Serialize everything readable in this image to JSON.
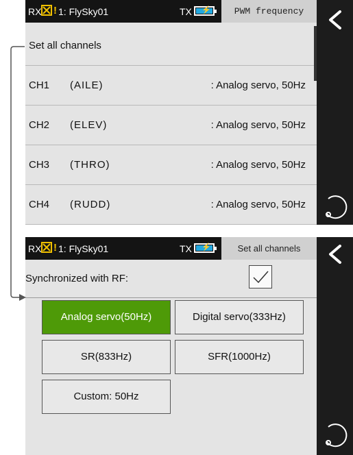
{
  "screen_top": {
    "status": {
      "rx": "RX",
      "warning": "!",
      "model": "1: FlySky01",
      "tx": "TX",
      "battery_bolt": "⚡"
    },
    "title": "PWM frequency",
    "set_all": "Set all channels",
    "channels": [
      {
        "ch": "CH1",
        "fn": "(AILE)",
        "value": ": Analog servo, 50Hz"
      },
      {
        "ch": "CH2",
        "fn": "(ELEV)",
        "value": ": Analog servo, 50Hz"
      },
      {
        "ch": "CH3",
        "fn": "(THRO)",
        "value": ": Analog servo, 50Hz"
      },
      {
        "ch": "CH4",
        "fn": "(RUDD)",
        "value": ": Analog servo, 50Hz"
      }
    ]
  },
  "screen_bottom": {
    "status": {
      "rx": "RX",
      "warning": "!",
      "model": "1: FlySky01",
      "tx": "TX",
      "battery_bolt": "⚡"
    },
    "title": "Set all channels",
    "sync_label": "Synchronized with RF:",
    "sync_checked": true,
    "options": [
      {
        "label": "Analog servo(50Hz)",
        "selected": true
      },
      {
        "label": "Digital servo(333Hz)",
        "selected": false
      },
      {
        "label": "SR(833Hz)",
        "selected": false
      },
      {
        "label": "SFR(1000Hz)",
        "selected": false
      },
      {
        "label": "Custom: 50Hz",
        "selected": false
      }
    ]
  },
  "icons": {
    "back": "chevron-left-icon",
    "refresh": "refresh-icon",
    "rx_alert": "x-box-icon",
    "check": "checkmark-icon"
  },
  "colors": {
    "status_bar": "#141414",
    "screen_bg": "#e4e4e4",
    "sidebar": "#1c1c1c",
    "selected_option": "#4e9a08",
    "warning": "#f0c000",
    "battery": "#22a8e0"
  }
}
